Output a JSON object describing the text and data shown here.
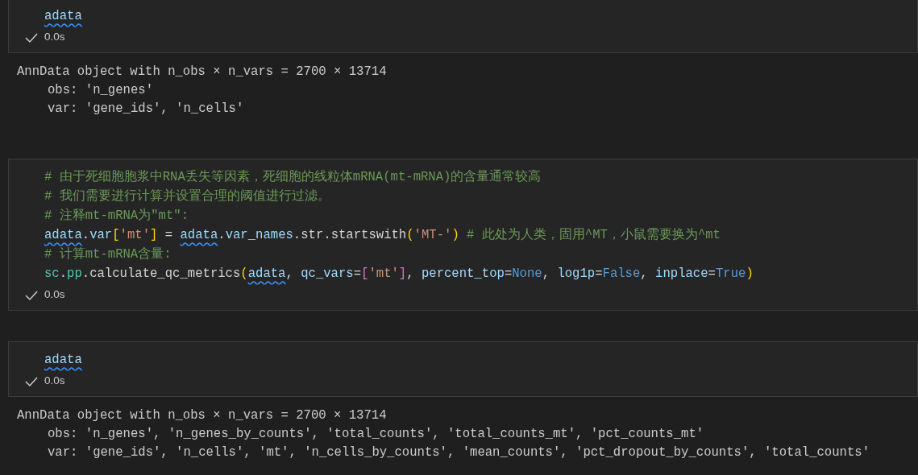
{
  "cells": [
    {
      "code": [
        [
          {
            "kind": "flagged",
            "text": "adata"
          }
        ]
      ],
      "status": {
        "succeeded": true,
        "time": "0.0s"
      },
      "output": {
        "header": "AnnData object with n_obs × n_vars = 2700 × 13714",
        "children": [
          "obs: 'n_genes'",
          "var: 'gene_ids', 'n_cells'"
        ]
      }
    },
    {
      "code": [
        [
          {
            "kind": "comment",
            "text": "# 由于死细胞胞浆中RNA丢失等因素，死细胞的线粒体mRNA(mt-mRNA)的含量通常较高"
          }
        ],
        [
          {
            "kind": "comment",
            "text": "# 我们需要进行计算并设置合理的阈值进行过滤。"
          }
        ],
        [
          {
            "kind": "comment",
            "text": "# 注释mt-mRNA为\"mt\":"
          }
        ],
        [
          {
            "kind": "flagged",
            "text": "adata"
          },
          {
            "kind": "plain",
            "text": "."
          },
          {
            "kind": "variable",
            "text": "var"
          },
          {
            "kind": "bracket1",
            "text": "["
          },
          {
            "kind": "string",
            "text": "'mt'"
          },
          {
            "kind": "bracket1",
            "text": "]"
          },
          {
            "kind": "plain",
            "text": " = "
          },
          {
            "kind": "flagged",
            "text": "adata"
          },
          {
            "kind": "plain",
            "text": "."
          },
          {
            "kind": "variable",
            "text": "var_names"
          },
          {
            "kind": "plain",
            "text": ".str.startswith"
          },
          {
            "kind": "bracket1",
            "text": "("
          },
          {
            "kind": "string",
            "text": "'MT-'"
          },
          {
            "kind": "bracket1",
            "text": ")"
          },
          {
            "kind": "comment",
            "text": " # 此处为人类，固用^MT，小鼠需要换为^mt"
          }
        ],
        [
          {
            "kind": "comment",
            "text": "# 计算mt-mRNA含量:"
          }
        ],
        [
          {
            "kind": "module",
            "text": "sc"
          },
          {
            "kind": "plain",
            "text": "."
          },
          {
            "kind": "module",
            "text": "pp"
          },
          {
            "kind": "plain",
            "text": ".calculate_qc_metrics"
          },
          {
            "kind": "bracket1",
            "text": "("
          },
          {
            "kind": "flagged",
            "text": "adata"
          },
          {
            "kind": "plain",
            "text": ", "
          },
          {
            "kind": "variable",
            "text": "qc_vars"
          },
          {
            "kind": "plain",
            "text": "="
          },
          {
            "kind": "bracket2",
            "text": "["
          },
          {
            "kind": "string",
            "text": "'mt'"
          },
          {
            "kind": "bracket2",
            "text": "]"
          },
          {
            "kind": "plain",
            "text": ", "
          },
          {
            "kind": "variable",
            "text": "percent_top"
          },
          {
            "kind": "plain",
            "text": "="
          },
          {
            "kind": "constant",
            "text": "None"
          },
          {
            "kind": "plain",
            "text": ", "
          },
          {
            "kind": "variable",
            "text": "log1p"
          },
          {
            "kind": "plain",
            "text": "="
          },
          {
            "kind": "constant",
            "text": "False"
          },
          {
            "kind": "plain",
            "text": ", "
          },
          {
            "kind": "variable",
            "text": "inplace"
          },
          {
            "kind": "plain",
            "text": "="
          },
          {
            "kind": "constant",
            "text": "True"
          },
          {
            "kind": "bracket1",
            "text": ")"
          }
        ]
      ],
      "status": {
        "succeeded": true,
        "time": "0.0s"
      }
    },
    {
      "code": [
        [
          {
            "kind": "flagged",
            "text": "adata"
          }
        ]
      ],
      "status": {
        "succeeded": true,
        "time": "0.0s"
      },
      "output": {
        "header": "AnnData object with n_obs × n_vars = 2700 × 13714",
        "children": [
          "obs: 'n_genes', 'n_genes_by_counts', 'total_counts', 'total_counts_mt', 'pct_counts_mt'",
          "var: 'gene_ids', 'n_cells', 'mt', 'n_cells_by_counts', 'mean_counts', 'pct_dropout_by_counts', 'total_counts'"
        ]
      }
    }
  ]
}
